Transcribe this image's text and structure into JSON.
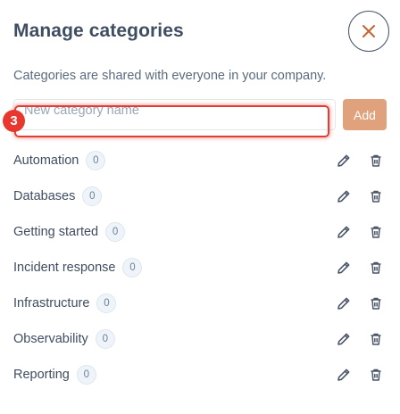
{
  "dialog": {
    "title": "Manage categories",
    "subtitle": "Categories are shared with everyone in your company.",
    "close_icon": "close-icon"
  },
  "new_category": {
    "placeholder": "New category name",
    "value": "",
    "add_label": "Add",
    "step_marker": "3"
  },
  "categories": [
    {
      "name": "Automation",
      "count": "0"
    },
    {
      "name": "Databases",
      "count": "0"
    },
    {
      "name": "Getting started",
      "count": "0"
    },
    {
      "name": "Incident response",
      "count": "0"
    },
    {
      "name": "Infrastructure",
      "count": "0"
    },
    {
      "name": "Observability",
      "count": "0"
    },
    {
      "name": "Reporting",
      "count": "0"
    }
  ],
  "colors": {
    "accent": "#e0a27d",
    "close_icon": "#c8622f",
    "focus_ring": "#e33c34",
    "title": "#3f4d61",
    "icon": "#4a5568"
  }
}
